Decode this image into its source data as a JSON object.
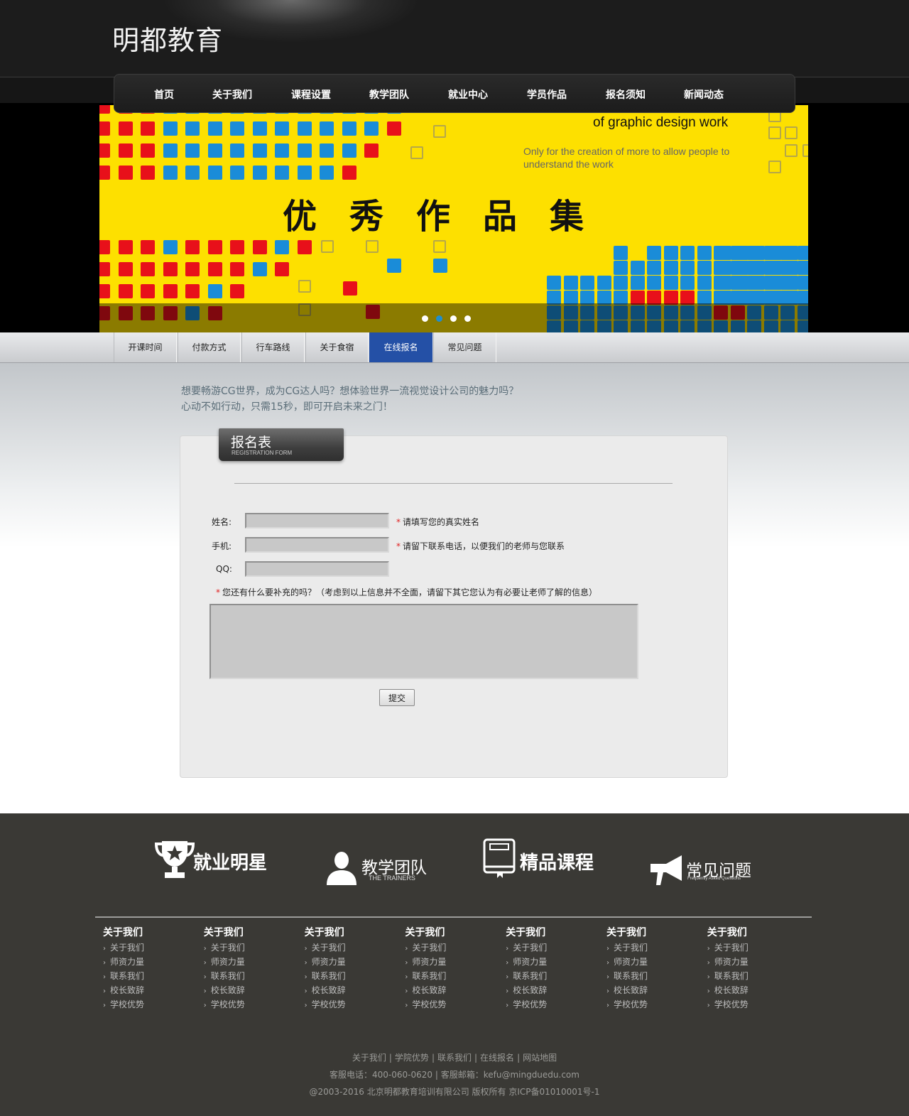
{
  "header": {
    "logo": "明都教育",
    "nav": [
      "首页",
      "关于我们",
      "课程设置",
      "教学团队",
      "就业中心",
      "学员作品",
      "报名须知",
      "新闻动态"
    ]
  },
  "banner": {
    "title_en": "of graphic design work",
    "subtitle_en": "Only for the creation of more to allow people to understand the work",
    "title_cn": "优秀作品集",
    "slides": 4,
    "active_slide": 2,
    "colors": {
      "yellow": "#fde000",
      "red": "#e8101a",
      "blue": "#1a8cd8"
    }
  },
  "subtabs": {
    "items": [
      "开课时间",
      "付款方式",
      "行车路线",
      "关于食宿",
      "在线报名",
      "常见问题"
    ],
    "active": 4
  },
  "intro": {
    "line1": "想要畅游CG世界，成为CG达人吗？想体验世界一流视觉设计公司的魅力吗？",
    "line2": "心动不如行动，只需15秒，即可开启未来之门！"
  },
  "form": {
    "title": "报名表",
    "subtitle": "REGISTRATION FORM",
    "name_label": "姓名:",
    "name_value": "",
    "name_hint": "请填写您的真实姓名",
    "phone_label": "手机:",
    "phone_value": "",
    "phone_hint": "请留下联系电话，以便我们的老师与您联系",
    "qq_label": "QQ:",
    "qq_value": "",
    "extra_hint": "您还有什么要补充的吗？（考虑到以上信息并不全面，请留下其它您认为有必要让老师了解的信息）",
    "extra_value": "",
    "required_mark": "*",
    "submit": "提交"
  },
  "footer": {
    "features": [
      {
        "title": "就业明星",
        "sub": "",
        "icon": "trophy-icon"
      },
      {
        "title": "教学团队",
        "sub": "THE TRAINERS",
        "icon": "person-icon"
      },
      {
        "title": "精品课程",
        "sub": "",
        "icon": "book-icon"
      },
      {
        "title": "常见问题",
        "sub": "Frequently Asked Questions",
        "icon": "megaphone-icon"
      }
    ],
    "columns": [
      {
        "title": "关于我们",
        "links": [
          "关于我们",
          "师资力量",
          "联系我们",
          "校长致辞",
          "学校优势"
        ]
      },
      {
        "title": "关于我们",
        "links": [
          "关于我们",
          "师资力量",
          "联系我们",
          "校长致辞",
          "学校优势"
        ]
      },
      {
        "title": "关于我们",
        "links": [
          "关于我们",
          "师资力量",
          "联系我们",
          "校长致辞",
          "学校优势"
        ]
      },
      {
        "title": "关于我们",
        "links": [
          "关于我们",
          "师资力量",
          "联系我们",
          "校长致辞",
          "学校优势"
        ]
      },
      {
        "title": "关于我们",
        "links": [
          "关于我们",
          "师资力量",
          "联系我们",
          "校长致辞",
          "学校优势"
        ]
      },
      {
        "title": "关于我们",
        "links": [
          "关于我们",
          "师资力量",
          "联系我们",
          "校长致辞",
          "学校优势"
        ]
      },
      {
        "title": "关于我们",
        "links": [
          "关于我们",
          "师资力量",
          "联系我们",
          "校长致辞",
          "学校优势"
        ]
      }
    ],
    "bottom_links": [
      "关于我们",
      "学院优势",
      "联系我们",
      "在线报名",
      "网站地图"
    ],
    "separator": "|",
    "contact": "客服电话：400-060-0620 | 客服邮箱：kefu@mingduedu.com",
    "copyright": "@2003-2016 北京明都教育培训有限公司 版权所有 京ICP备01010001号-1"
  }
}
